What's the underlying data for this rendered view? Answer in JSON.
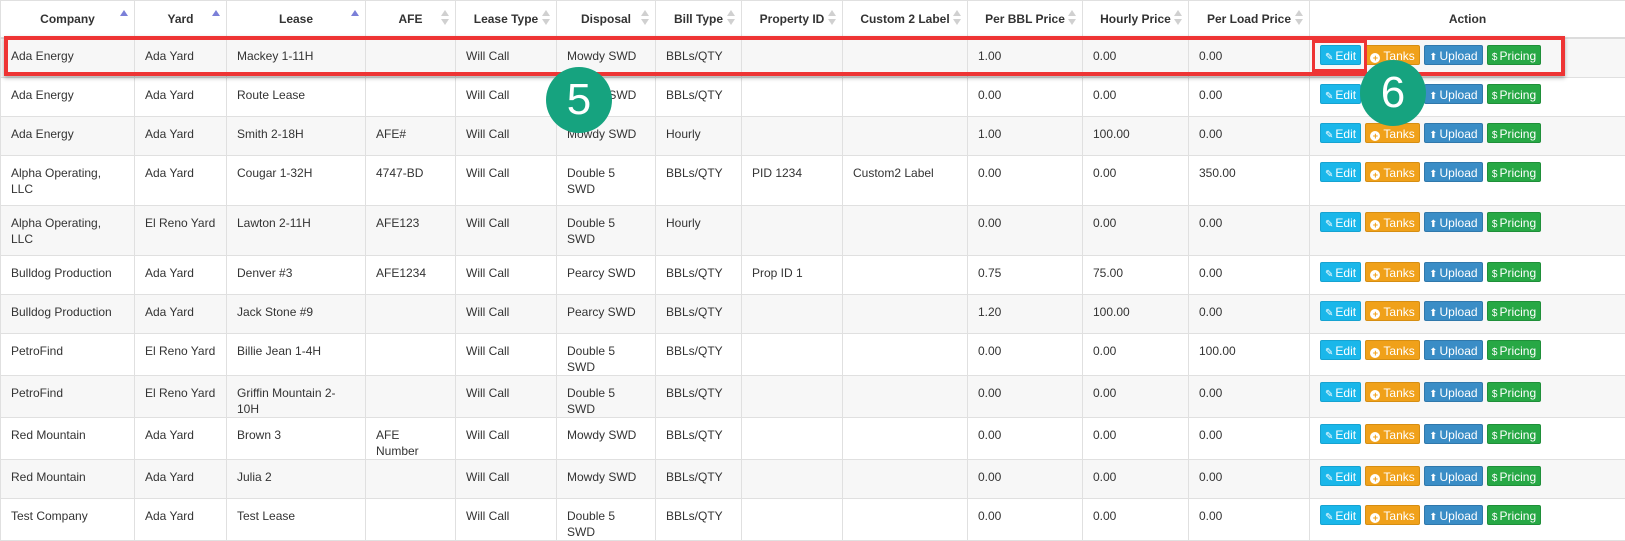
{
  "columns": [
    {
      "label": "Company",
      "sort": "asc"
    },
    {
      "label": "Yard",
      "sort": "asc"
    },
    {
      "label": "Lease",
      "sort": "asc"
    },
    {
      "label": "AFE",
      "sort": "both"
    },
    {
      "label": "Lease Type",
      "sort": "both"
    },
    {
      "label": "Disposal",
      "sort": "both"
    },
    {
      "label": "Bill Type",
      "sort": "both"
    },
    {
      "label": "Property ID",
      "sort": "both"
    },
    {
      "label": "Custom 2 Label",
      "sort": "both"
    },
    {
      "label": "Per BBL Price",
      "sort": "both"
    },
    {
      "label": "Hourly Price",
      "sort": "both"
    },
    {
      "label": "Per Load Price",
      "sort": "both"
    },
    {
      "label": "Action",
      "sort": "none"
    }
  ],
  "rows": [
    [
      "Ada Energy",
      "Ada Yard",
      "Mackey 1-11H",
      "",
      "Will Call",
      "Mowdy SWD",
      "BBLs/QTY",
      "",
      "",
      "1.00",
      "0.00",
      "0.00"
    ],
    [
      "Ada Energy",
      "Ada Yard",
      "Route Lease",
      "",
      "Will Call",
      "Mowdy SWD",
      "BBLs/QTY",
      "",
      "",
      "0.00",
      "0.00",
      "0.00"
    ],
    [
      "Ada Energy",
      "Ada Yard",
      "Smith 2-18H",
      "AFE#",
      "Will Call",
      "Mowdy SWD",
      "Hourly",
      "",
      "",
      "1.00",
      "100.00",
      "0.00"
    ],
    [
      "Alpha Operating, LLC",
      "Ada Yard",
      "Cougar 1-32H",
      "4747-BD",
      "Will Call",
      "Double 5 SWD",
      "BBLs/QTY",
      "PID 1234",
      "Custom2 Label",
      "0.00",
      "0.00",
      "350.00"
    ],
    [
      "Alpha Operating, LLC",
      "El Reno Yard",
      "Lawton 2-11H",
      "AFE123",
      "Will Call",
      "Double 5 SWD",
      "Hourly",
      "",
      "",
      "0.00",
      "0.00",
      "0.00"
    ],
    [
      "Bulldog Production",
      "Ada Yard",
      "Denver #3",
      "AFE1234",
      "Will Call",
      "Pearcy SWD",
      "BBLs/QTY",
      "Prop ID 1",
      "",
      "0.75",
      "75.00",
      "0.00"
    ],
    [
      "Bulldog Production",
      "Ada Yard",
      "Jack Stone #9",
      "",
      "Will Call",
      "Pearcy SWD",
      "BBLs/QTY",
      "",
      "",
      "1.20",
      "100.00",
      "0.00"
    ],
    [
      "PetroFind",
      "El Reno Yard",
      "Billie Jean 1-4H",
      "",
      "Will Call",
      "Double 5 SWD",
      "BBLs/QTY",
      "",
      "",
      "0.00",
      "0.00",
      "100.00"
    ],
    [
      "PetroFind",
      "El Reno Yard",
      "Griffin Mountain 2-10H",
      "",
      "Will Call",
      "Double 5 SWD",
      "BBLs/QTY",
      "",
      "",
      "0.00",
      "0.00",
      "0.00"
    ],
    [
      "Red Mountain",
      "Ada Yard",
      "Brown 3",
      "AFE Number",
      "Will Call",
      "Mowdy SWD",
      "BBLs/QTY",
      "",
      "",
      "0.00",
      "0.00",
      "0.00"
    ],
    [
      "Red Mountain",
      "Ada Yard",
      "Julia 2",
      "",
      "Will Call",
      "Mowdy SWD",
      "BBLs/QTY",
      "",
      "",
      "0.00",
      "0.00",
      "0.00"
    ],
    [
      "Test Company",
      "Ada Yard",
      "Test Lease",
      "",
      "Will Call",
      "Double 5 SWD",
      "BBLs/QTY",
      "",
      "",
      "0.00",
      "0.00",
      "0.00"
    ]
  ],
  "actions": {
    "edit": "Edit",
    "tanks": "Tanks",
    "upload": "Upload",
    "pricing": "Pricing"
  },
  "icons": {
    "edit": "edit-icon",
    "tanks": "plus-circle-icon",
    "upload": "upload-icon",
    "pricing": "dollar-icon"
  },
  "callouts": {
    "step_5": "5",
    "step_6": "6"
  },
  "colors": {
    "edit": "#1ab7ea",
    "tanks": "#f0a11a",
    "upload": "#3a8dc6",
    "pricing": "#27a845",
    "highlight": "#ee3434",
    "badge": "#16a37f"
  }
}
